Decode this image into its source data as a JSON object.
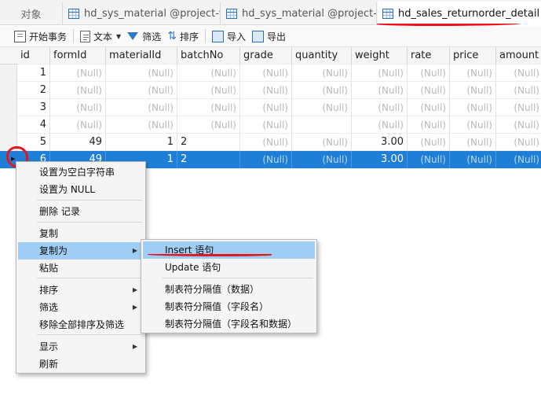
{
  "tabs": [
    {
      "label": "对象",
      "icon": ""
    },
    {
      "label": "hd_sys_material @project-y...",
      "icon": "table-icon"
    },
    {
      "label": "hd_sys_material @project-y...",
      "icon": "table-icon"
    },
    {
      "label": "hd_sales_returnorder_detail",
      "icon": "table-icon"
    }
  ],
  "toolbar": {
    "begin_transaction": "开始事务",
    "text": "文本",
    "filter": "筛选",
    "sort": "排序",
    "import": "导入",
    "export": "导出"
  },
  "grid": {
    "columns": [
      "id",
      "formId",
      "materialId",
      "batchNo",
      "grade",
      "quantity",
      "weight",
      "rate",
      "price",
      "amount"
    ],
    "rows": [
      [
        "1",
        "(Null)",
        "(Null)",
        "(Null)",
        "(Null)",
        "(Null)",
        "(Null)",
        "(Null)",
        "(Null)",
        "(Null)"
      ],
      [
        "2",
        "(Null)",
        "(Null)",
        "(Null)",
        "(Null)",
        "(Null)",
        "(Null)",
        "(Null)",
        "(Null)",
        "(Null)"
      ],
      [
        "3",
        "(Null)",
        "(Null)",
        "(Null)",
        "(Null)",
        "(Null)",
        "(Null)",
        "(Null)",
        "(Null)",
        "(Null)"
      ],
      [
        "4",
        "(Null)",
        "(Null)",
        "(Null)",
        "(Null)",
        "",
        "(Null)",
        "(Null)",
        "(Null)",
        "(Null)"
      ],
      [
        "5",
        "49",
        "1",
        "2",
        "(Null)",
        "(Null)",
        "3.00",
        "(Null)",
        "(Null)",
        "(Null)"
      ],
      [
        "6",
        "49",
        "1",
        "2",
        "(Null)",
        "(Null)",
        "3.00",
        "(Null)",
        "(Null)",
        "(Null)"
      ]
    ],
    "selected_row": 6,
    "row_indicator": "▸"
  },
  "context_menu": {
    "items": [
      {
        "label": "设置为空白字符串"
      },
      {
        "label": "设置为 NULL"
      },
      {
        "label": "删除 记录"
      },
      {
        "label": "复制"
      },
      {
        "label": "复制为",
        "has_submenu": true,
        "highlighted": true
      },
      {
        "label": "粘贴"
      },
      {
        "label": "排序",
        "has_submenu": true
      },
      {
        "label": "筛选",
        "has_submenu": true
      },
      {
        "label": "移除全部排序及筛选"
      },
      {
        "label": "显示",
        "has_submenu": true
      },
      {
        "label": "刷新"
      }
    ],
    "submenu_arrow": "▶"
  },
  "copy_as_submenu": {
    "items": [
      {
        "label": "Insert 语句",
        "highlighted": true
      },
      {
        "label": "Update 语句"
      },
      {
        "label": "制表符分隔值（数据）"
      },
      {
        "label": "制表符分隔值（字段名）"
      },
      {
        "label": "制表符分隔值（字段名和数据）"
      }
    ]
  },
  "colors": {
    "selection": "#1f7fd6",
    "menu_highlight": "#9fcdf3",
    "annotation": "#e4161c",
    "null_text": "#b9b9b9"
  }
}
